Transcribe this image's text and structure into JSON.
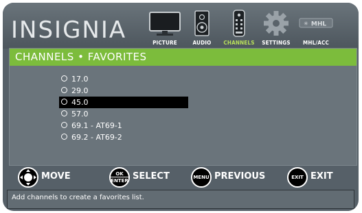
{
  "brand": "INSIGNIA",
  "nav": [
    {
      "id": "picture",
      "label": "PICTURE",
      "icon": "tv-icon",
      "active": false
    },
    {
      "id": "audio",
      "label": "AUDIO",
      "icon": "speaker-icon",
      "active": false
    },
    {
      "id": "channels",
      "label": "CHANNELS",
      "icon": "remote-icon",
      "active": true
    },
    {
      "id": "settings",
      "label": "SETTINGS",
      "icon": "gear-icon",
      "active": false
    },
    {
      "id": "mhl",
      "label": "MHL/ACC",
      "icon": "mhl-icon",
      "active": false
    }
  ],
  "mhl_logo_text": "MHL",
  "panel": {
    "title": "CHANNELS • FAVORITES",
    "channels": [
      {
        "label": "17.0",
        "selected": false
      },
      {
        "label": "29.0",
        "selected": false
      },
      {
        "label": "45.0",
        "selected": true
      },
      {
        "label": "57.0",
        "selected": false
      },
      {
        "label": "69.1 - AT69-1",
        "selected": false
      },
      {
        "label": "69.2 - AT69-2",
        "selected": false
      }
    ]
  },
  "controls": {
    "move": {
      "label": "MOVE"
    },
    "select": {
      "label": "SELECT",
      "key_top": "OK",
      "key_bottom": "ENTER"
    },
    "previous": {
      "label": "PREVIOUS",
      "key": "MENU"
    },
    "exit": {
      "label": "EXIT",
      "key": "EXIT"
    }
  },
  "help_text": "Add channels to create a favorites list.",
  "colors": {
    "accent": "#7cbc3c",
    "active_nav": "#b8e05a",
    "background": "#566068"
  }
}
